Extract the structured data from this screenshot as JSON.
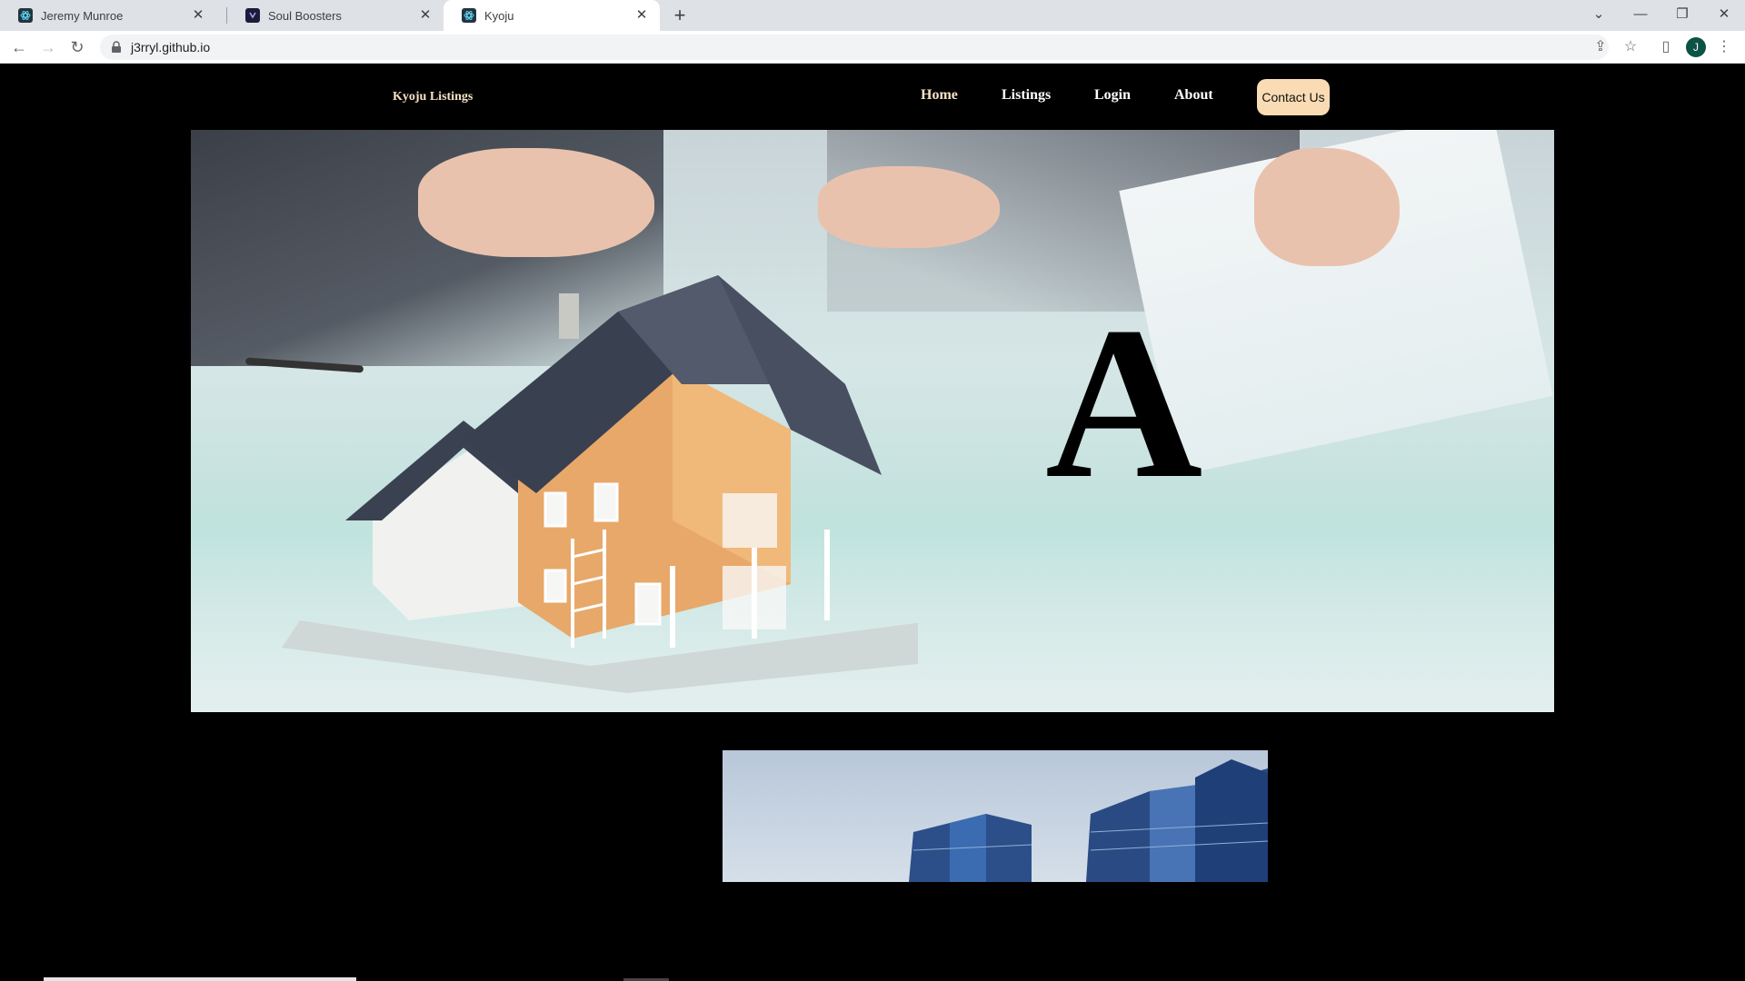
{
  "browser": {
    "tabs": [
      {
        "title": "Jeremy Munroe",
        "active": false
      },
      {
        "title": "Soul Boosters",
        "active": false
      },
      {
        "title": "Kyoju",
        "active": true
      }
    ],
    "url": "j3rryl.github.io",
    "profile_initial": "J"
  },
  "site": {
    "brand": "Kyoju Listings",
    "nav": {
      "home": "Home",
      "listings": "Listings",
      "login": "Login",
      "about": "About",
      "contact": "Contact Us"
    },
    "hero_letter": "A"
  },
  "colors": {
    "page_bg": "#000000",
    "brand": "#f6e3c5",
    "contact_button": "#fadcb4",
    "avatar": "#0b5345"
  }
}
